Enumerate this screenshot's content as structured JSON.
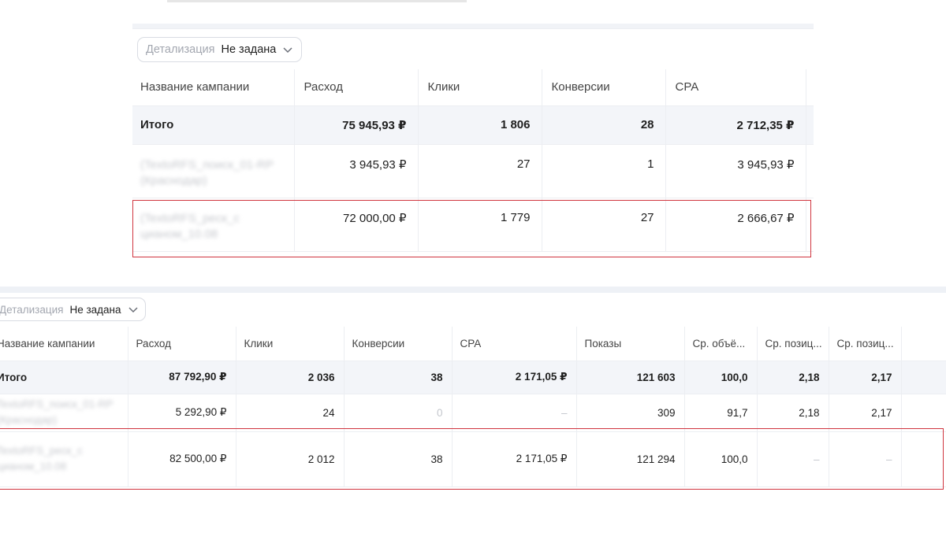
{
  "top": {
    "detail": {
      "label": "Детализация",
      "value": "Не задана"
    },
    "headers": [
      "Название кампании",
      "Расход",
      "Клики",
      "Конверсии",
      "CPA"
    ],
    "total": {
      "name": "Итого",
      "spend": "75 945,93 ₽",
      "clicks": "1 806",
      "conversions": "28",
      "cpa": "2 712,35 ₽"
    },
    "rows": [
      {
        "name_line1": "(TextoRFS_поиск_01-RP",
        "name_line2": "(Краснодар)",
        "spend": "3 945,93 ₽",
        "clicks": "27",
        "conversions": "1",
        "cpa": "3 945,93 ₽"
      },
      {
        "name_line1": "(TextoRFS_реск_с",
        "name_line2": "цианом_10.08",
        "spend": "72 000,00 ₽",
        "clicks": "1 779",
        "conversions": "27",
        "cpa": "2 666,67 ₽"
      }
    ]
  },
  "bottom": {
    "detail": {
      "label": "Детализация",
      "value": "Не задана"
    },
    "headers": [
      "Название кампании",
      "Расход",
      "Клики",
      "Конверсии",
      "CPA",
      "Показы",
      "Ср. объё...",
      "Ср. позиц...",
      "Ср. позиц..."
    ],
    "total": {
      "name": "Итого",
      "spend": "87 792,90 ₽",
      "clicks": "2 036",
      "conversions": "38",
      "cpa": "2 171,05 ₽",
      "impressions": "121 603",
      "avg_volume": "100,0",
      "avg_pos1": "2,18",
      "avg_pos2": "2,17"
    },
    "rows": [
      {
        "name_line1": "TextoRFS_поиск_01-RP",
        "name_line2": "(Краснодар)",
        "spend": "5 292,90 ₽",
        "clicks": "24",
        "conversions": "0",
        "cpa": "–",
        "impressions": "309",
        "avg_volume": "91,7",
        "avg_pos1": "2,18",
        "avg_pos2": "2,17"
      },
      {
        "name_line1": "TextoRFS_реск_с",
        "name_line2": "цианом_10.08",
        "spend": "82 500,00 ₽",
        "clicks": "2 012",
        "conversions": "38",
        "cpa": "2 171,05 ₽",
        "impressions": "121 294",
        "avg_volume": "100,0",
        "avg_pos1": "–",
        "avg_pos2": "–"
      }
    ]
  },
  "colors": {
    "highlight": "#d0343e",
    "total_row_bg": "#f3f5f9",
    "grid": "#eceef2"
  },
  "icons": {
    "detail_dropdown": "chevron-down-icon"
  }
}
